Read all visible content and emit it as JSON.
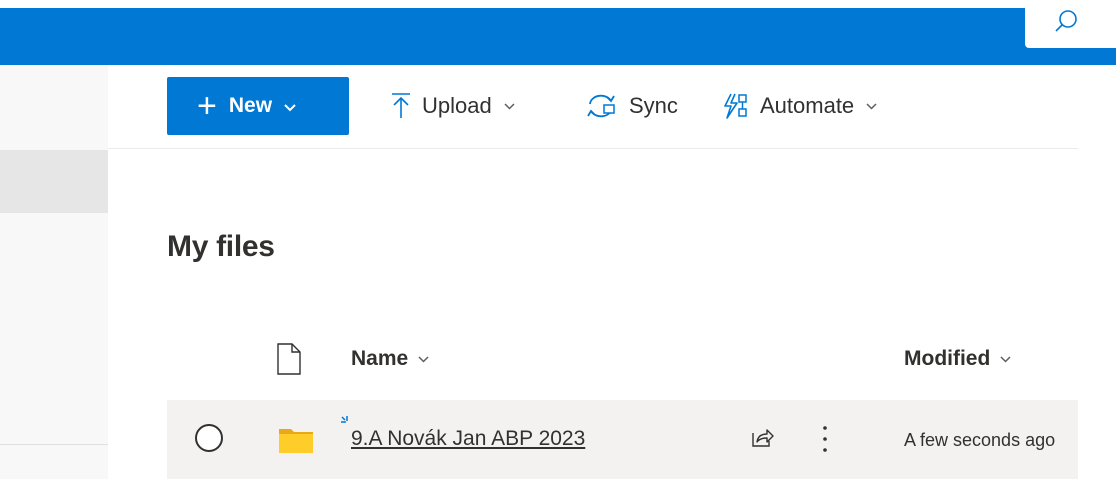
{
  "commandbar": {
    "new_label": "New",
    "upload_label": "Upload",
    "sync_label": "Sync",
    "automate_label": "Automate"
  },
  "page": {
    "title": "My files"
  },
  "columns": {
    "name": "Name",
    "modified": "Modified"
  },
  "files": [
    {
      "name": "9.A Novák Jan ABP 2023",
      "modified": "A few seconds ago",
      "type": "folder"
    }
  ],
  "colors": {
    "accent": "#0078d4",
    "folder": "#ffcd29",
    "row_hover": "#f3f2f1"
  },
  "icons": {
    "search": "search-icon",
    "upload": "upload-icon",
    "sync": "sync-icon",
    "automate": "automate-icon",
    "file_type": "file-type-icon",
    "folder": "folder-icon",
    "share": "share-icon",
    "more": "more-icon"
  }
}
